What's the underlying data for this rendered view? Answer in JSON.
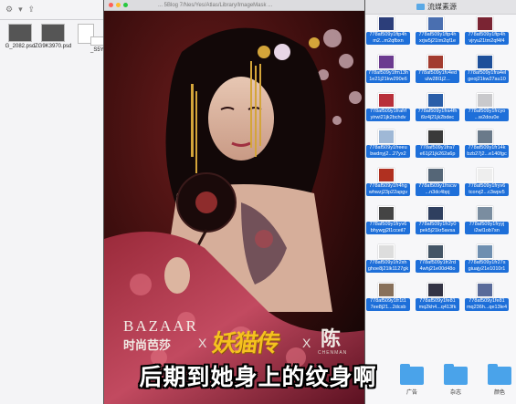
{
  "left_window": {
    "files": [
      {
        "name": "G_2082.psd",
        "kind": "photo"
      },
      {
        "name": "ZG9K3970.psd",
        "kind": "photo"
      },
      {
        "name": "",
        "kind": "doc"
      },
      {
        "name": "_S5Y3",
        "kind": "doc"
      }
    ]
  },
  "preview": {
    "title": "... 5Blog 7/Nes/Yes/Atlas/Library/ImageMask ..."
  },
  "poster": {
    "brand_en": "BAZAAR",
    "brand_zh": "时尚芭莎",
    "x1": "X",
    "collab_title": "妖猫传",
    "x2": "X",
    "artist_char": "陈",
    "artist_en": "CHENMAN"
  },
  "subtitle": "后期到她身上的纹身啊",
  "right_window": {
    "title": "流媒素源",
    "tiles": [
      {
        "l1": "778af509y1ftp4h",
        "l2": "m2...m2qfbxn",
        "color": "#2c3e7a"
      },
      {
        "l1": "778af509y1ftp4h",
        "l2": "xrjw5j21tm2qf1e",
        "color": "#4a6fb0"
      },
      {
        "l1": "778af509y1ftp4h",
        "l2": "vjryu21tm2qf4f4",
        "color": "#7a2433"
      },
      {
        "l1": "778af509y1fm13h",
        "l2": "1e21j21kw290e6",
        "color": "#6b3a8f"
      },
      {
        "l1": "778af509y1fv4ed",
        "l2": "ulw28l1j2...",
        "color": "#a23b2f"
      },
      {
        "l1": "778af509y1fra4el",
        "l2": "geoj21kw27au10",
        "color": "#1d4f9a"
      },
      {
        "l1": "778af509y1frafrf",
        "l2": "yirwi21jk2bchdv",
        "color": "#b8303a"
      },
      {
        "l1": "778af509y1fra4fh",
        "l2": "i9z4j21jk2bdec",
        "color": "#2a5ea8"
      },
      {
        "l1": "778af509y1frcyo",
        "l2": "...w2dou0e",
        "color": "#c9c9cc"
      },
      {
        "l1": "778af509y1freeu",
        "l2": "bwdnyj2...27yx2",
        "color": "#9fb8d6"
      },
      {
        "l1": "778af509y1fra7",
        "l2": "e61j21jk262a6p",
        "color": "#3a3a3a"
      },
      {
        "l1": "778af509y1fr14k",
        "l2": "bzb27j2...e140fgc",
        "color": "#6a7a8a"
      },
      {
        "l1": "778af509y1fr4hg",
        "l2": "whwzj23p22apgv",
        "color": "#b03020"
      },
      {
        "l1": "778af509y1frscw",
        "l2": "...n3dc4bpj",
        "color": "#556677"
      },
      {
        "l1": "778af509y1fryv6",
        "l2": "tcorvj2...c3wpv5",
        "color": "#eeeeee"
      },
      {
        "l1": "778af509y1fryv6",
        "l2": "bhywgj2l1cceil7",
        "color": "#444444"
      },
      {
        "l1": "778af509y1fr2y0",
        "l2": "pek5j21kr5avsa",
        "color": "#2f3f5f"
      },
      {
        "l1": "778af509y1fryyj",
        "l2": "i2wl1ob7sn",
        "color": "#7a8da0"
      },
      {
        "l1": "778af509y1fr2xh",
        "l2": "ghoe8j21lk1127gk",
        "color": "#dddddd"
      },
      {
        "l1": "778af509y1fr2rd",
        "l2": "4whj21e00d48o",
        "color": "#445566"
      },
      {
        "l1": "778af509y1fr27s",
        "l2": "giuajy21e1010r1",
        "color": "#6f8fb0"
      },
      {
        "l1": "778af509y1fr1t1",
        "l2": "7ee8j21...2dcsb",
        "color": "#88705a"
      },
      {
        "l1": "778af509y1fe81",
        "l2": "mq2kh4...q413fk",
        "color": "#333344"
      },
      {
        "l1": "778af509y1fe81",
        "l2": "mq236h...qe13le4",
        "color": "#5a6b9a"
      }
    ],
    "folders": [
      "广告",
      "杂志",
      "颜色"
    ]
  }
}
